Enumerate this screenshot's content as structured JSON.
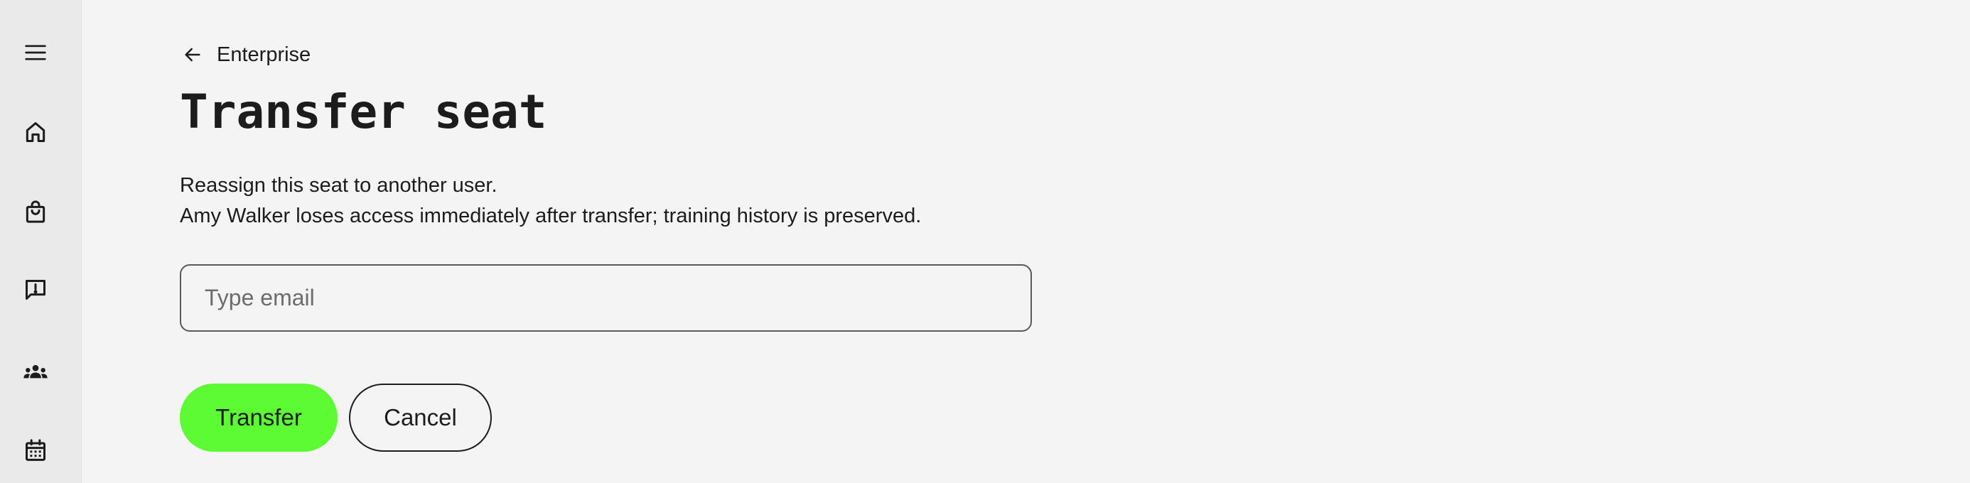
{
  "sidebar": {
    "items": [
      {
        "icon": "menu-icon",
        "label": "Menu"
      },
      {
        "icon": "home-icon",
        "label": "Home"
      },
      {
        "icon": "shopping-bag-icon",
        "label": "Shop"
      },
      {
        "icon": "feedback-icon",
        "label": "Feedback"
      },
      {
        "icon": "groups-icon",
        "label": "People"
      },
      {
        "icon": "calendar-icon",
        "label": "Calendar"
      }
    ]
  },
  "breadcrumb": {
    "icon": "arrow-back-icon",
    "label": "Enterprise"
  },
  "page": {
    "title": "Transfer seat",
    "description_line1": "Reassign this seat to another user.",
    "description_line2": "Amy Walker loses access immediately after transfer; training history is preserved."
  },
  "form": {
    "email_value": "",
    "email_placeholder": "Type email",
    "transfer_label": "Transfer",
    "cancel_label": "Cancel"
  },
  "colors": {
    "background": "#f4f4f4",
    "sidebar": "#eaeaea",
    "accent": "#5cfb34",
    "text": "#1c1c1c"
  }
}
